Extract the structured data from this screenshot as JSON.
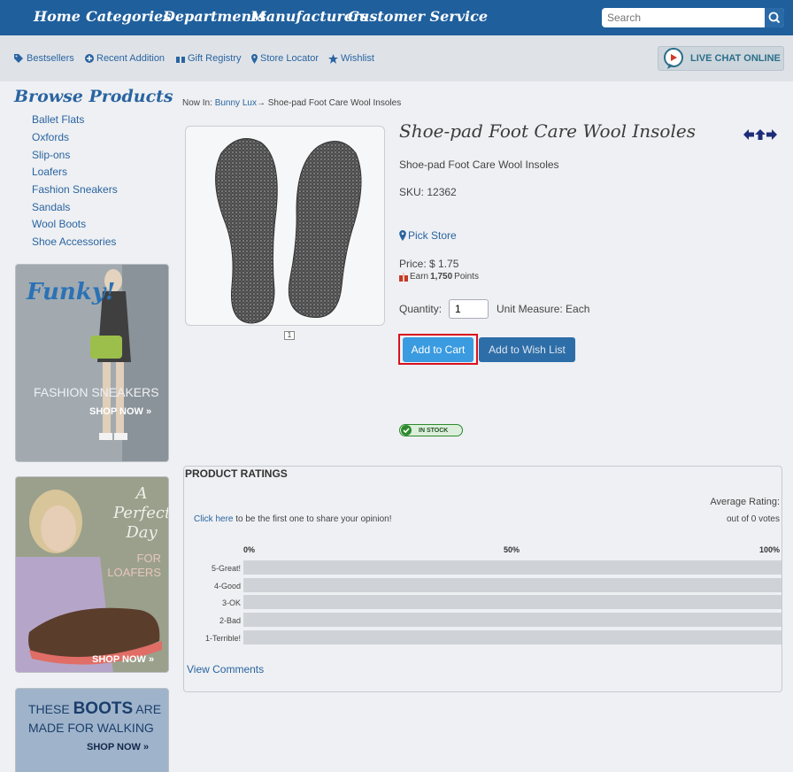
{
  "nav": {
    "items": [
      "Home",
      "Categories",
      "Departments",
      "Manufacturers",
      "Customer Service"
    ],
    "search_placeholder": "Search"
  },
  "subnav": {
    "links": [
      "Bestsellers",
      "Recent Addition",
      "Gift Registry",
      "Store Locator",
      "Wishlist"
    ],
    "chat_label": "LIVE CHAT ONLINE"
  },
  "sidebar": {
    "title": "Browse Products",
    "categories": [
      "Ballet Flats",
      "Oxfords",
      "Slip-ons",
      "Loafers",
      "Fashion Sneakers",
      "Sandals",
      "Wool Boots",
      "Shoe Accessories"
    ],
    "banners": [
      {
        "headline": "Funky!",
        "subtitle": "FASHION SNEAKERS",
        "cta": "SHOP NOW"
      },
      {
        "headline_lines": [
          "A",
          "Perfect",
          "Day"
        ],
        "subtitle_lines": [
          "FOR",
          "LOAFERS"
        ],
        "cta": "SHOP NOW"
      },
      {
        "line1_prefix": "THESE",
        "line1_bold": "BOOTS",
        "line1_suffix": "ARE",
        "line2": "MADE FOR WALKING",
        "cta": "SHOP NOW"
      }
    ]
  },
  "breadcrumb": {
    "prefix": "Now In:",
    "link": "Bunny Lux",
    "arrow": "→",
    "current": "Shoe-pad Foot Care Wool Insoles"
  },
  "product": {
    "title": "Shoe-pad Foot Care Wool Insoles",
    "subtitle": "Shoe-pad Foot Care Wool Insoles",
    "sku": "SKU: 12362",
    "pick_store": "Pick Store",
    "price": "Price: $ 1.75",
    "earn_prefix": "Earn",
    "earn_points": "1,750",
    "earn_suffix": "Points",
    "quantity_label": "Quantity:",
    "quantity_value": "1",
    "unit_measure": "Unit Measure:  Each",
    "add_to_cart": "Add to Cart",
    "add_to_wishlist": "Add to Wish List",
    "stock": "IN STOCK",
    "thumb_number": "1"
  },
  "ratings": {
    "title": "PRODUCT RATINGS",
    "average_label": "Average Rating:",
    "votes": "out of 0 votes",
    "click_here": "Click here",
    "first_opinion": "to be the first one to share your opinion!",
    "pct_labels": [
      "0%",
      "50%",
      "100%"
    ],
    "rows": [
      "5-Great!",
      "4-Good",
      "3-OK",
      "2-Bad",
      "1-Terrible!"
    ],
    "view_comments": "View Comments"
  },
  "colors": {
    "nav_bg": "#1f5f9c",
    "link": "#2a64a0",
    "cart_button": "#3a9be0",
    "wishlist_button": "#2e6ea8",
    "highlight": "#d9121f"
  }
}
